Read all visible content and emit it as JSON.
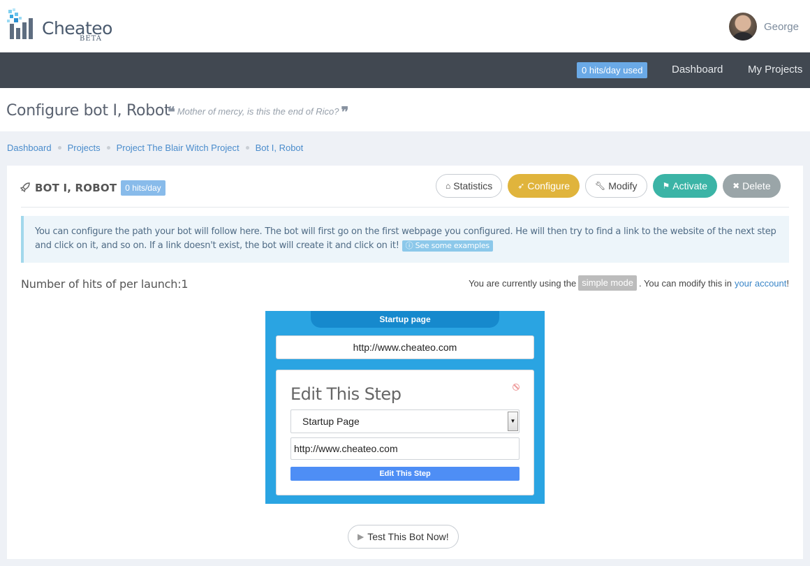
{
  "header": {
    "logo_text": "Cheateo",
    "logo_badge": "BETA",
    "user_name": "George"
  },
  "nav": {
    "hits_used": "0 hits/day used",
    "dashboard": "Dashboard",
    "my_projects": "My Projects"
  },
  "page": {
    "title": "Configure bot I, Robot",
    "quote": "Mother of mercy, is this the end of Rico?"
  },
  "breadcrumb": [
    "Dashboard",
    "Projects",
    "Project The Blair Witch Project",
    "Bot I, Robot"
  ],
  "bot": {
    "name": "BOT I, ROBOT",
    "hits": "0 hits/day",
    "actions": {
      "statistics": "Statistics",
      "configure": "Configure",
      "modify": "Modify",
      "activate": "Activate",
      "delete": "Delete"
    }
  },
  "info": {
    "text": "You can configure the path your bot will follow here. The bot will first go on the first webpage you configured. He will then try to find a link to the website of the next step and click on it, and so on. If a link doesn't exist, the bot will create it and click on it!",
    "examples": "See some examples"
  },
  "hits_per_launch": "Number of hits of per launch:1",
  "mode": {
    "prefix": "You are currently using the",
    "badge": "simple mode",
    "middle": ". You can modify this in",
    "link": "your account",
    "suffix": "!"
  },
  "builder": {
    "tab_label": "Startup page",
    "url": "http://www.cheateo.com",
    "edit": {
      "title": "Edit This Step",
      "select_value": "Startup Page",
      "url_value": "http://www.cheateo.com",
      "button": "Edit This Step"
    }
  },
  "test_button": "Test This Bot Now!",
  "colors": {
    "navbar": "#414851",
    "builder": "#2aa4e2",
    "configure": "#e0b43c",
    "activate": "#3bb4a6",
    "delete": "#9aa5a8",
    "edit_button": "#4e8ef5"
  }
}
